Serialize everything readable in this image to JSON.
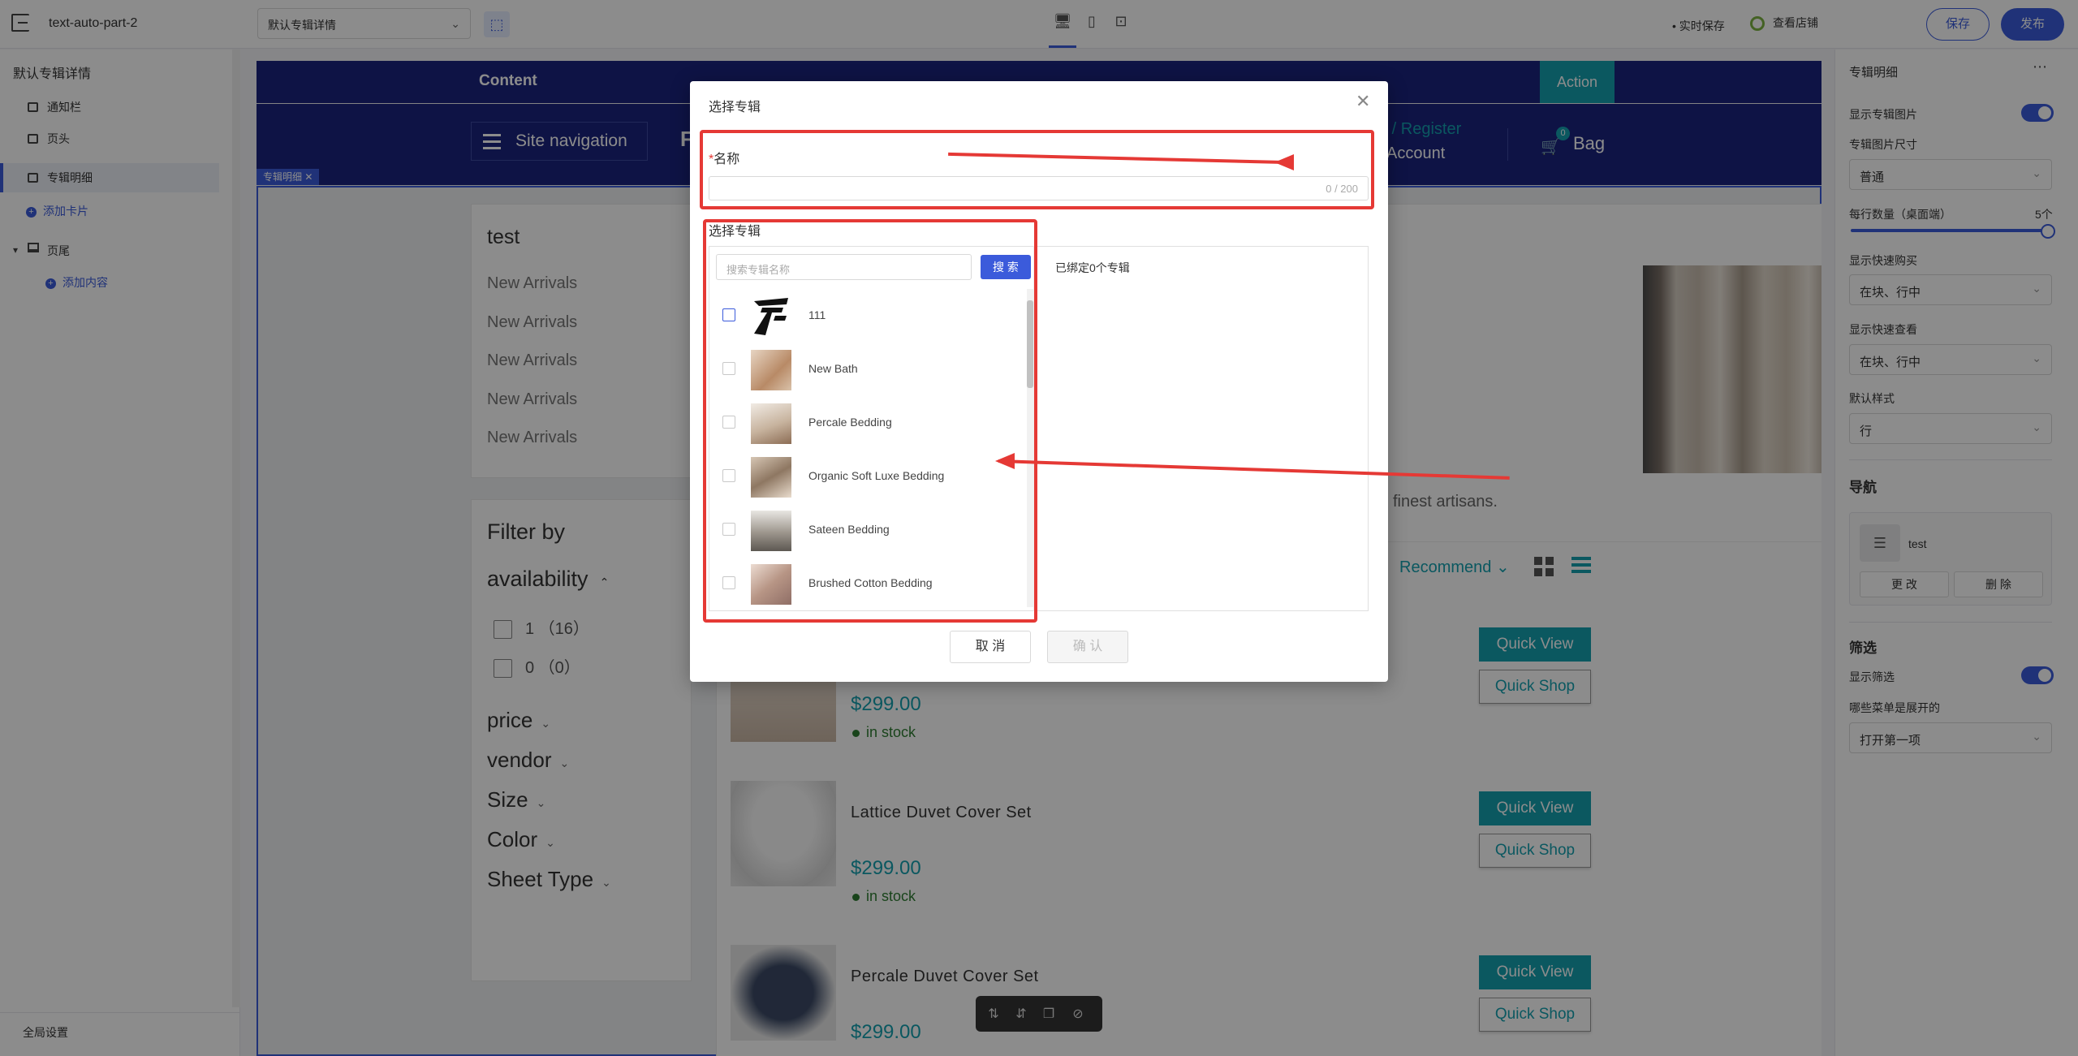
{
  "topbar": {
    "project": "text-auto-part-2",
    "template_select": "默认专辑详情",
    "autosave": "• 实时保存",
    "view_store": "查看店铺",
    "save": "保存",
    "publish": "发布"
  },
  "left": {
    "title": "默认专辑详情",
    "items": [
      {
        "label": "通知栏"
      },
      {
        "label": "页头"
      },
      {
        "label": "专辑明细"
      }
    ],
    "add_card": "添加卡片",
    "footer": "页尾",
    "add_content": "添加内容",
    "global": "全局设置"
  },
  "store": {
    "content": "Content",
    "action": "Action",
    "site_nav": "Site navigation",
    "logo_char": "F",
    "register": "n / Register",
    "account": "Account",
    "bag": "Bag",
    "bag_count": "0",
    "tag": "专辑明细 ✕",
    "menu_title": "test",
    "menu_items": [
      "New Arrivals",
      "New Arrivals",
      "New Arrivals",
      "New Arrivals",
      "New Arrivals"
    ],
    "filter_by": "Filter by",
    "availability": "availability",
    "avail_opts": [
      "1 （16）",
      "0 （0）"
    ],
    "filters": [
      "price",
      "vendor",
      "Size",
      "Color",
      "Sheet Type"
    ],
    "artisans": "finest artisans.",
    "recommend": "Recommend",
    "products": [
      {
        "title": "",
        "price": "$299.00",
        "stock": "in stock"
      },
      {
        "title": "Lattice Duvet Cover Set",
        "price": "$299.00",
        "stock": "in stock"
      },
      {
        "title": "Percale Duvet Cover Set",
        "price": "$299.00",
        "stock": ""
      }
    ],
    "quick_view": "Quick View",
    "quick_shop": "Quick Shop"
  },
  "right": {
    "title": "专辑明细",
    "show_img": "显示专辑图片",
    "img_size": "专辑图片尺寸",
    "img_size_val": "普通",
    "per_row": "每行数量（桌面端）",
    "per_row_val": "5个",
    "quick_buy": "显示快速购买",
    "quick_buy_val": "在块、行中",
    "quick_view": "显示快速查看",
    "quick_view_val": "在块、行中",
    "default_style": "默认样式",
    "default_style_val": "行",
    "nav": "导航",
    "nav_item": "test",
    "edit": "更 改",
    "delete": "删 除",
    "filter": "筛选",
    "show_filter": "显示筛选",
    "expand": "哪些菜单是展开的",
    "expand_val": "打开第一项"
  },
  "modal": {
    "title": "选择专辑",
    "name_label": "名称",
    "counter": "0 / 200",
    "select_label": "选择专辑",
    "search_placeholder": "搜索专辑名称",
    "search_btn": "搜 索",
    "bound": "已绑定0个专辑",
    "items": [
      "111",
      "New Bath",
      "Percale Bedding",
      "Organic Soft Luxe Bedding",
      "Sateen Bedding",
      "Brushed Cotton Bedding"
    ],
    "cancel": "取 消",
    "confirm": "确 认"
  }
}
